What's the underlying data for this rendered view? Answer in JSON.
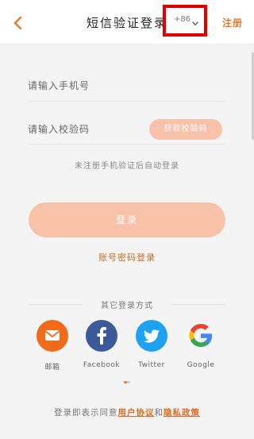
{
  "header": {
    "title": "短信验证登录",
    "register_label": "注册",
    "back_icon": "chevron-left-icon"
  },
  "form": {
    "phone_placeholder": "请输入手机号",
    "country_code": "+86",
    "code_placeholder": "请输入校验码",
    "get_code_label": "获取校验码",
    "hint": "未注册手机验证后自动登录",
    "login_label": "登录",
    "password_login_label": "账号密码登录"
  },
  "social": {
    "title": "其它登录方式",
    "items": [
      {
        "label": "邮箱",
        "icon": "mail-icon",
        "color": "#f06a1a"
      },
      {
        "label": "Facebook",
        "icon": "facebook-icon",
        "color": "#3c5a99"
      },
      {
        "label": "Twitter",
        "icon": "twitter-icon",
        "color": "#1ea1f1"
      },
      {
        "label": "Google",
        "icon": "google-icon",
        "color": "#4285f4"
      }
    ]
  },
  "agreement": {
    "prefix": "登录即表示同意",
    "user_agreement": "用户协议",
    "and": "和",
    "privacy_policy": "隐私政策"
  },
  "colors": {
    "accent": "#e8782e",
    "button_disabled": "#f8c2a8",
    "highlight_box": "#e00000"
  }
}
